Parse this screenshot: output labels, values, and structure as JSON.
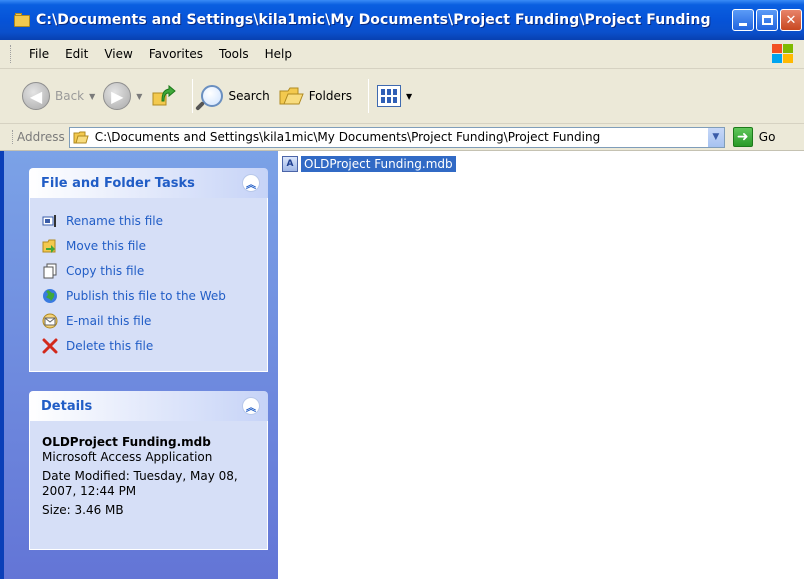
{
  "window": {
    "title": "C:\\Documents and Settings\\kila1mic\\My Documents\\Project Funding\\Project Funding"
  },
  "menu": {
    "items": [
      "File",
      "Edit",
      "View",
      "Favorites",
      "Tools",
      "Help"
    ]
  },
  "toolbar": {
    "back_label": "Back",
    "search_label": "Search",
    "folders_label": "Folders"
  },
  "address": {
    "label": "Address",
    "value": "C:\\Documents and Settings\\kila1mic\\My Documents\\Project Funding\\Project Funding",
    "go_label": "Go"
  },
  "tasks_panel": {
    "title": "File and Folder Tasks",
    "items": [
      {
        "label": "Rename this file",
        "icon": "rename-icon"
      },
      {
        "label": "Move this file",
        "icon": "move-icon"
      },
      {
        "label": "Copy this file",
        "icon": "copy-icon"
      },
      {
        "label": "Publish this file to the Web",
        "icon": "globe-icon"
      },
      {
        "label": "E-mail this file",
        "icon": "email-icon"
      },
      {
        "label": "Delete this file",
        "icon": "delete-icon"
      }
    ]
  },
  "details_panel": {
    "title": "Details",
    "file_name": "OLDProject Funding.mdb",
    "file_type": "Microsoft Access Application",
    "date_modified": "Date Modified: Tuesday, May 08, 2007, 12:44 PM",
    "size": "Size: 3.46 MB"
  },
  "files": [
    {
      "name": "OLDProject Funding.mdb",
      "selected": true
    }
  ],
  "colors": {
    "titlebar": "#0653d8",
    "task_link": "#215dc6",
    "selection": "#316ac5",
    "taskpane_bg": "#7ba2e7"
  }
}
